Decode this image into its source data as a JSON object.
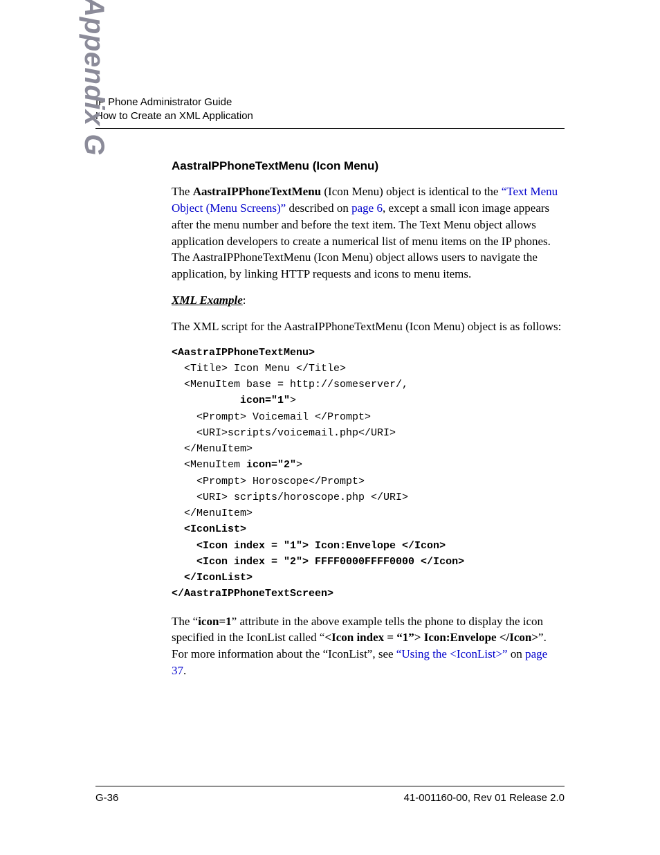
{
  "header": {
    "line1": "IP Phone Administrator Guide",
    "line2": "How to Create an XML Application"
  },
  "side_tab": "Appendix G",
  "section_heading": "AastraIPPhoneTextMenu (Icon Menu)",
  "intro": {
    "pre": "The ",
    "bold1": "AastraIPPhoneTextMenu",
    "mid1": " (Icon Menu) object is identical to the ",
    "link1": "“Text Menu Object (Menu Screens)”",
    "mid2": " described on ",
    "link2": "page 6",
    "tail": ", except a small icon image appears after the menu number and before the text item. The Text Menu object allows application developers to create a numerical list of menu items on the IP phones. The AastraIPPhoneTextMenu (Icon Menu) object allows users to navigate the application, by linking HTTP requests and icons to menu items."
  },
  "xml_example_label_text": "XML Example",
  "xml_example_label_colon": ":",
  "xml_intro": "The XML script for the AastraIPPhoneTextMenu (Icon Menu) object is as follows:",
  "code": {
    "l01b": "<AastraIPPhoneTextMenu>",
    "l02": "  <Title> Icon Menu </Title>",
    "l03": "  <MenuItem base = http://someserver/,",
    "l04a": "           ",
    "l04b": "icon=\"1\"",
    "l04c": ">",
    "l05": "    <Prompt> Voicemail </Prompt>",
    "l06": "    <URI>scripts/voicemail.php</URI>",
    "l07": "  </MenuItem>",
    "l08a": "  <MenuItem ",
    "l08b": "icon=\"2\"",
    "l08c": ">",
    "l09": "    <Prompt> Horoscope</Prompt>",
    "l10": "    <URI> scripts/horoscope.php </URI>",
    "l11": "  </MenuItem>",
    "l12b": "  <IconList>",
    "l13b": "    <Icon index = \"1\"> Icon:Envelope </Icon>",
    "l14b": "    <Icon index = \"2\"> FFFF0000FFFF0000 </Icon>",
    "l15b": "  </IconList>",
    "l16b": "</AastraIPPhoneTextScreen>"
  },
  "outro": {
    "t1": "The “",
    "b1": "icon=1",
    "t2": "” attribute in the above example tells the phone to display the icon specified in the IconList called “",
    "b2": "<Icon index = “1”> Icon:Envelope </Icon>",
    "t3": "”. For more information about the “IconList”, see ",
    "link1": "“Using the <IconList>”",
    "t4": " on ",
    "link2": "page 37",
    "t5": "."
  },
  "footer": {
    "left": "G-36",
    "right": "41-001160-00, Rev 01 Release 2.0"
  }
}
